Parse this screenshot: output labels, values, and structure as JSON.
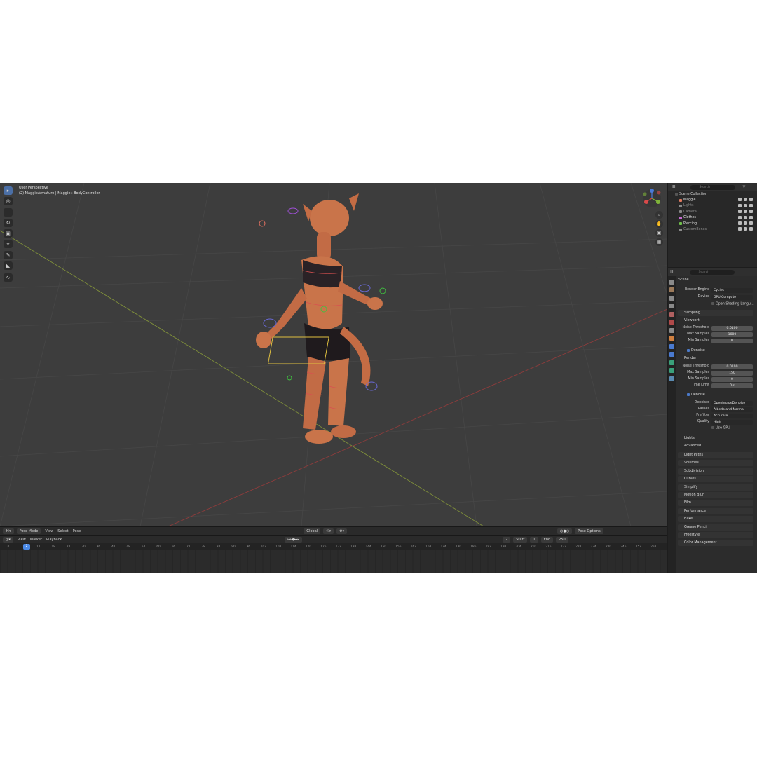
{
  "viewport": {
    "title": "User Perspective",
    "subtitle": "(2) MaggieArmature | Maggie : BodyController"
  },
  "header": {
    "mode": "Pose Mode",
    "menus": [
      "View",
      "Select",
      "Pose"
    ],
    "transform": "Global",
    "pose_options": "Pose Options"
  },
  "timeline": {
    "menus": [
      "View",
      "Marker",
      "Playback"
    ],
    "current_frame": "2",
    "start_label": "Start",
    "start": "1",
    "end_label": "End",
    "end": "250",
    "ticks": [
      "0",
      "2",
      "12",
      "18",
      "24",
      "30",
      "36",
      "42",
      "48",
      "54",
      "60",
      "66",
      "72",
      "78",
      "84",
      "90",
      "96",
      "102",
      "108",
      "114",
      "120",
      "126",
      "132",
      "138",
      "144",
      "150",
      "156",
      "162",
      "168",
      "174",
      "180",
      "186",
      "192",
      "198",
      "204",
      "210",
      "216",
      "222",
      "228",
      "234",
      "240",
      "246",
      "252",
      "258"
    ]
  },
  "outliner": {
    "search_placeholder": "Search",
    "root": "Scene Collection",
    "items": [
      {
        "label": "Maggie",
        "color": "#e07a5f"
      },
      {
        "label": "Lights",
        "color": "#8a8a8a"
      },
      {
        "label": "Camera",
        "color": "#8a8a8a"
      },
      {
        "label": "Clothes",
        "color": "#c56ad1"
      },
      {
        "label": "Piercing",
        "color": "#6fbf4a"
      },
      {
        "label": "CustomBones",
        "color": "#8a8a8a"
      }
    ]
  },
  "properties": {
    "search_placeholder": "Search",
    "context": "Scene",
    "render_engine_label": "Render Engine",
    "render_engine": "Cycles",
    "device_label": "Device",
    "device": "GPU Compute",
    "osl": "Open Shading Langu...",
    "sampling": "Sampling",
    "viewport": "Viewport",
    "noise_threshold_label": "Noise Threshold",
    "vp_noise": "0.0100",
    "max_samples_label": "Max Samples",
    "vp_max": "1000",
    "min_samples_label": "Min Samples",
    "vp_min": "0",
    "denoise": "Denoise",
    "render": "Render",
    "r_noise": "0.0100",
    "r_max": "150",
    "r_min": "0",
    "time_limit_label": "Time Limit",
    "r_time": "0 s",
    "denoiser_label": "Denoiser",
    "denoiser": "OpenImageDenoise",
    "passes_label": "Passes",
    "passes": "Albedo and Normal",
    "prefilter_label": "Prefilter",
    "prefilter": "Accurate",
    "quality_label": "Quality",
    "quality": "High",
    "use_gpu": "Use GPU",
    "lights": "Lights",
    "advanced": "Advanced",
    "sections": [
      "Light Paths",
      "Volumes",
      "Subdivision",
      "Curves",
      "Simplify",
      "Motion Blur",
      "Film",
      "Performance",
      "Bake",
      "Grease Pencil",
      "Freestyle",
      "Color Management"
    ]
  }
}
